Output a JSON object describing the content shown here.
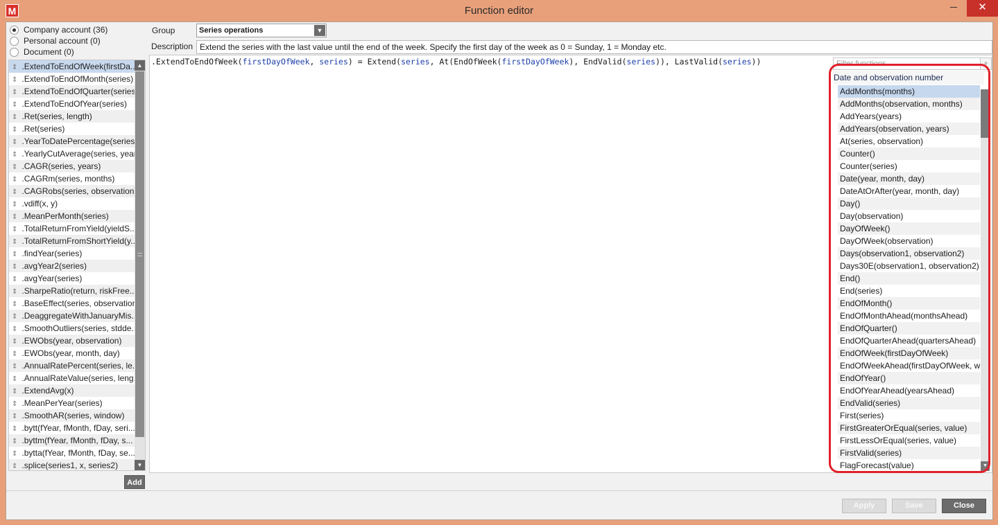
{
  "window": {
    "title": "Function editor",
    "logo_letter": "M",
    "minimize_label": "",
    "maximize_label": "□",
    "close_label": "✕"
  },
  "accounts": [
    {
      "label": "Company account (36)",
      "checked": true
    },
    {
      "label": "Personal account (0)",
      "checked": false
    },
    {
      "label": "Document (0)",
      "checked": false
    }
  ],
  "functions": [
    ".ExtendToEndOfWeek(firstDa...",
    ".ExtendToEndOfMonth(series)",
    ".ExtendToEndOfQuarter(series)",
    ".ExtendToEndOfYear(series)",
    ".Ret(series, length)",
    ".Ret(series)",
    ".YearToDatePercentage(series)",
    ".YearlyCutAverage(series, year)",
    ".CAGR(series, years)",
    ".CAGRm(series, months)",
    ".CAGRobs(series, observation)",
    ".vdiff(x, y)",
    ".MeanPerMonth(series)",
    ".TotalReturnFromYield(yieldS...",
    ".TotalReturnFromShortYield(y...",
    ".findYear(series)",
    ".avgYear2(series)",
    ".avgYear(series)",
    ".SharpeRatio(return, riskFree...",
    ".BaseEffect(series, observation)",
    ".DeaggregateWithJanuaryMis...",
    ".SmoothOutliers(series, stdde...",
    ".EWObs(year, observation)",
    ".EWObs(year, month, day)",
    ".AnnualRatePercent(series, le...",
    ".AnnualRateValue(series, leng...",
    ".ExtendAvg(x)",
    ".MeanPerYear(series)",
    ".SmoothAR(series, window)",
    ".bytt(fYear, fMonth, fDay, seri...",
    ".byttm(fYear, fMonth, fDay, s...",
    ".bytta(fYear, fMonth, fDay, se...",
    ".splice(series1, x, series2)"
  ],
  "add_label": "Add",
  "group": {
    "label": "Group",
    "value": "Series operations"
  },
  "description": {
    "label": "Description",
    "value": "Extend the series with the last value until the end of the week. Specify the first day of the week as 0 = Sunday, 1 = Monday etc."
  },
  "code": {
    "tokens": [
      {
        "t": ".ExtendToEndOfWeek(",
        "p": false
      },
      {
        "t": "firstDayOfWeek",
        "p": true
      },
      {
        "t": ", ",
        "p": false
      },
      {
        "t": "series",
        "p": true
      },
      {
        "t": ") = Extend(",
        "p": false
      },
      {
        "t": "series",
        "p": true
      },
      {
        "t": ", At(EndOfWeek(",
        "p": false
      },
      {
        "t": "firstDayOfWeek",
        "p": true
      },
      {
        "t": "), EndValid(",
        "p": false
      },
      {
        "t": "series",
        "p": true
      },
      {
        "t": ")), LastValid(",
        "p": false
      },
      {
        "t": "series",
        "p": true
      },
      {
        "t": "))",
        "p": false
      }
    ]
  },
  "browser": {
    "filter_placeholder": "Filter functions",
    "category": "Date and observation number",
    "items": [
      "AddMonths(months)",
      "AddMonths(observation, months)",
      "AddYears(years)",
      "AddYears(observation, years)",
      "At(series, observation)",
      "Counter()",
      "Counter(series)",
      "Date(year, month, day)",
      "DateAtOrAfter(year, month, day)",
      "Day()",
      "Day(observation)",
      "DayOfWeek()",
      "DayOfWeek(observation)",
      "Days(observation1, observation2)",
      "Days30E(observation1, observation2)",
      "End()",
      "End(series)",
      "EndOfMonth()",
      "EndOfMonthAhead(monthsAhead)",
      "EndOfQuarter()",
      "EndOfQuarterAhead(quartersAhead)",
      "EndOfWeek(firstDayOfWeek)",
      "EndOfWeekAhead(firstDayOfWeek, w",
      "EndOfYear()",
      "EndOfYearAhead(yearsAhead)",
      "EndValid(series)",
      "First(series)",
      "FirstGreaterOrEqual(series, value)",
      "FirstLessOrEqual(series, value)",
      "FirstValid(series)",
      "FlagForecast(value)"
    ]
  },
  "buttons": {
    "apply": "Apply",
    "save": "Save",
    "close": "Close"
  },
  "colors": {
    "annotation": "#e0202a",
    "parameter": "#1c3fa8",
    "selection": "#c6d8ee"
  }
}
